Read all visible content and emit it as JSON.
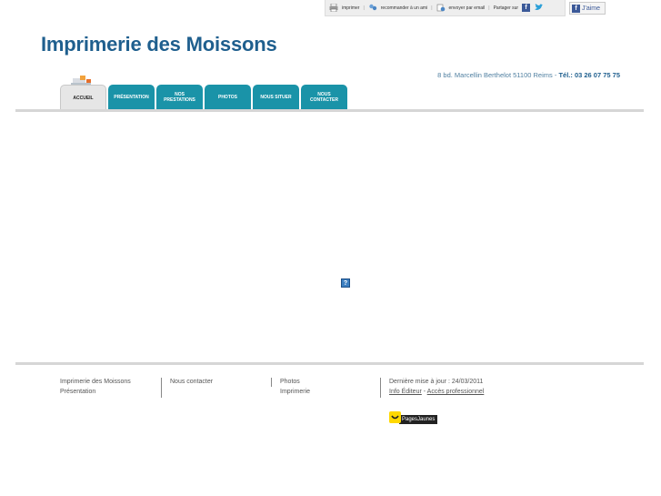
{
  "topbar": {
    "print": "imprimer",
    "recommend": "recommander à un ami",
    "email": "envoyer par email",
    "share": "Partager sur",
    "like": "J'aime"
  },
  "header": {
    "title": "Imprimerie des Moissons",
    "address": "8 bd. Marcellin Berthelot 51100 Reims  -",
    "phone": "Tél.: 03 26 07 75 75"
  },
  "nav": {
    "tabs": [
      {
        "label": "ACCUEIL"
      },
      {
        "label": "PRÉSENTATION"
      },
      {
        "label": "NOS PRESTATIONS"
      },
      {
        "label": "PHOTOS"
      },
      {
        "label": "NOUS SITUER"
      },
      {
        "label": "NOUS CONTACTER"
      }
    ]
  },
  "content": {
    "placeholder": "?"
  },
  "footer": {
    "col1": [
      "Imprimerie des Moissons",
      "Présentation"
    ],
    "col2": [
      "Nous contacter"
    ],
    "col3": [
      "Photos",
      "Imprimerie"
    ],
    "updated": "Dernière mise à jour : 24/03/2011",
    "info_editeur": "Info Éditeur",
    "dash": "-",
    "acces_pro": "Accès professionnel",
    "pagesjaunes": "PagesJaunes"
  },
  "colors": {
    "accent": "#1a93a8",
    "title": "#1f5f8e"
  }
}
